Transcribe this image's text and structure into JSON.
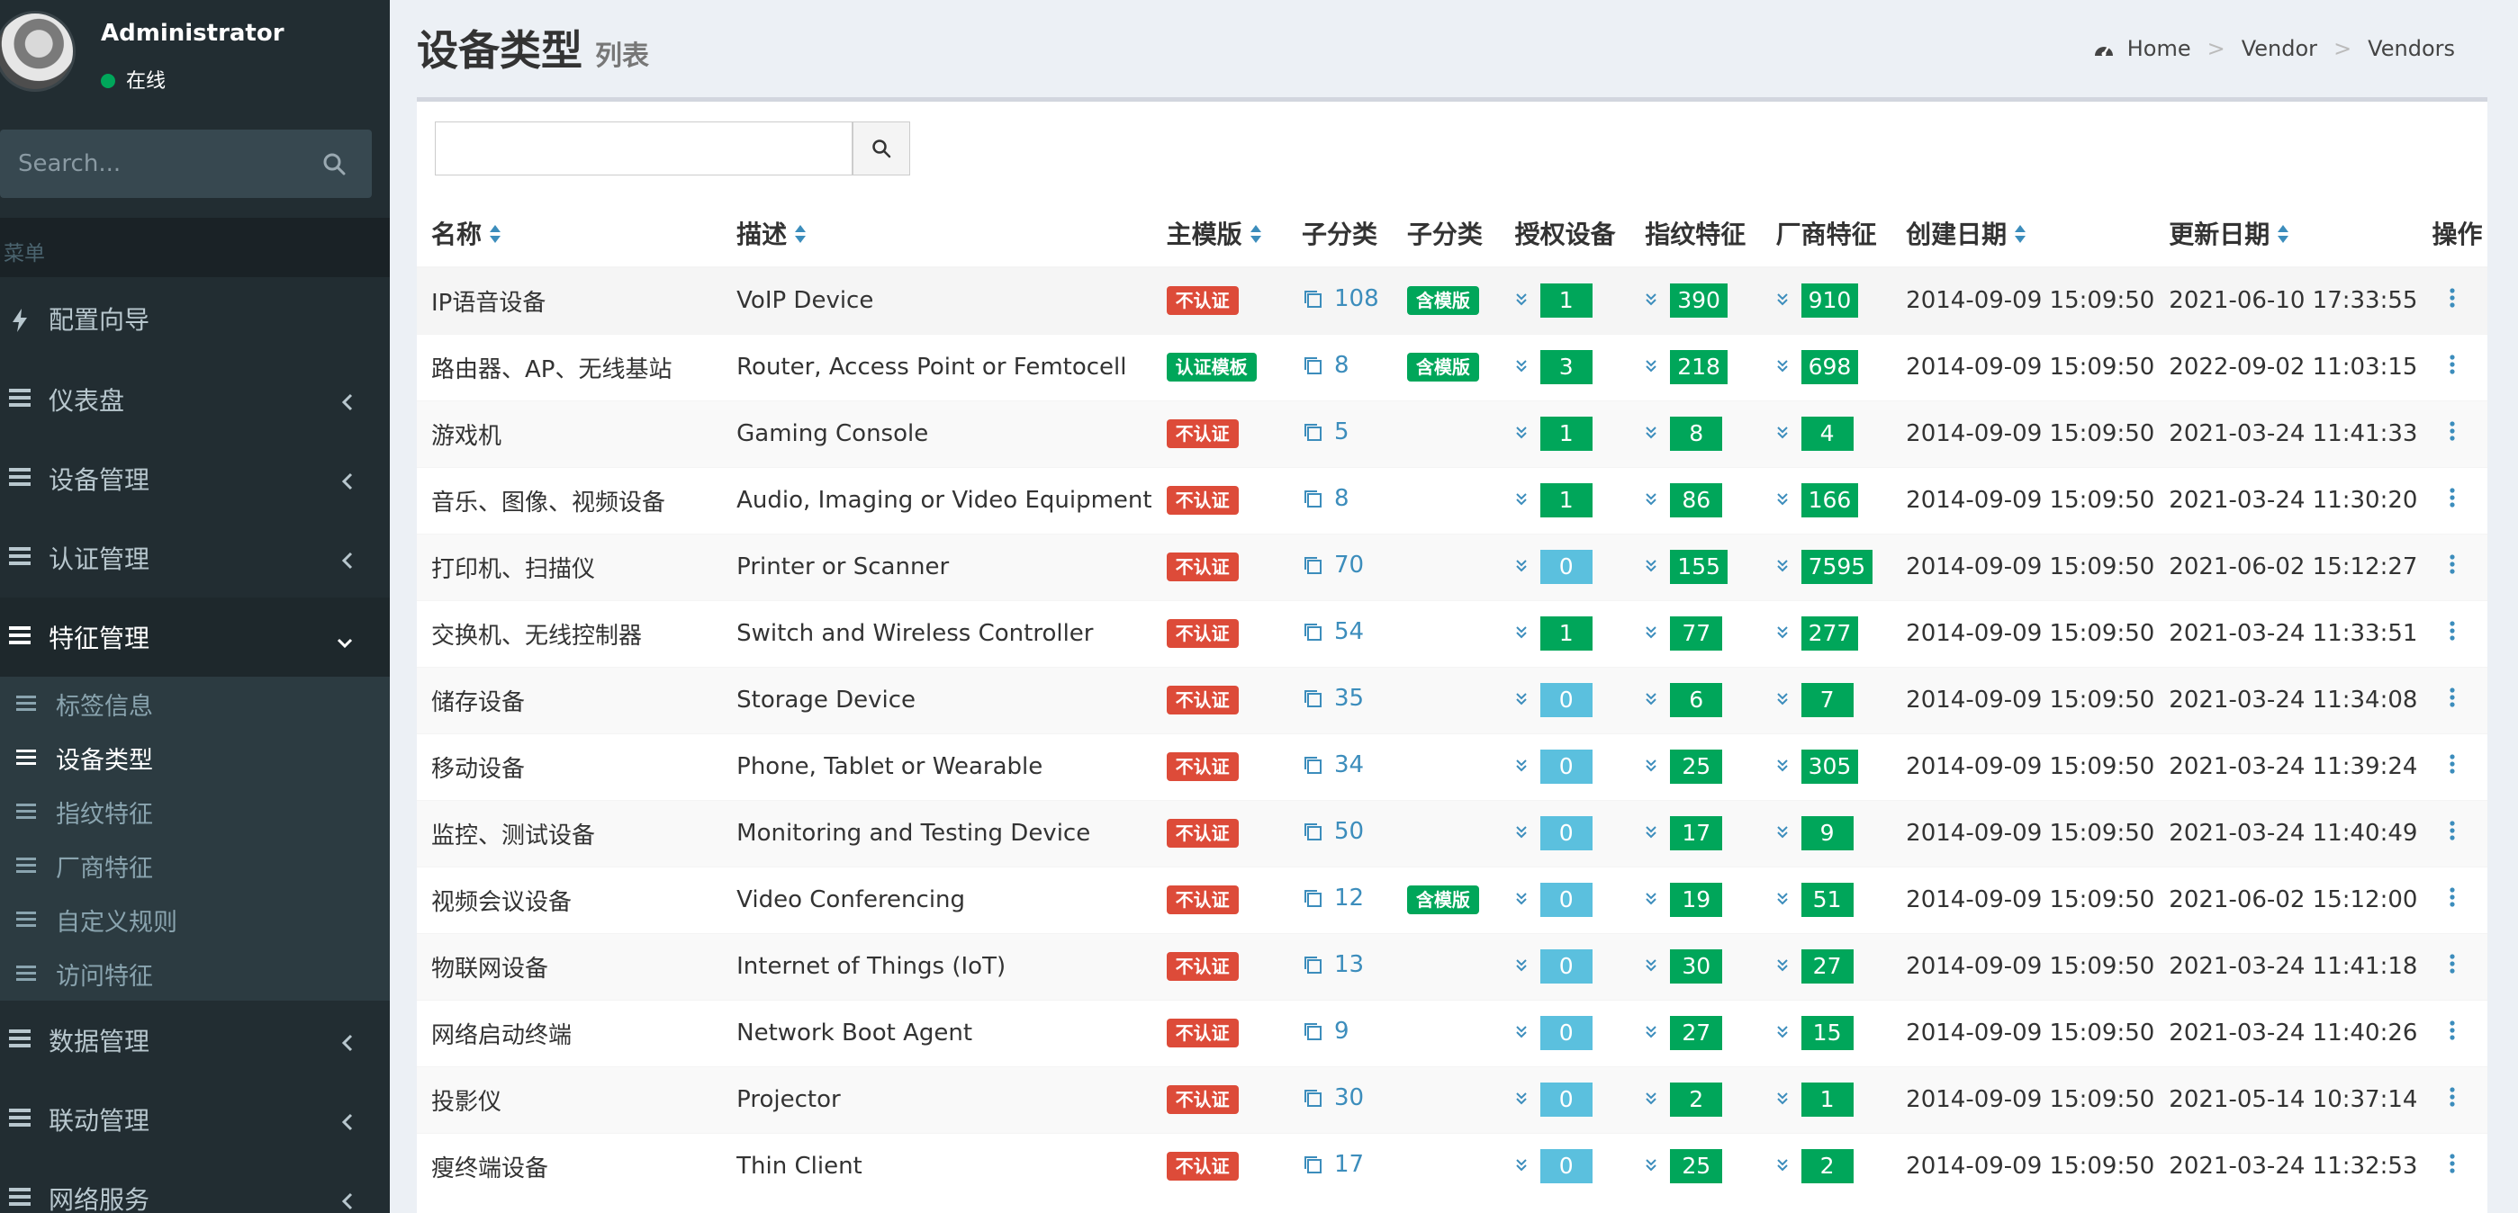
{
  "user": {
    "name": "Administrator",
    "status": "在线"
  },
  "sidebar": {
    "search_placeholder": "Search...",
    "menu_header": "菜单",
    "wizard": "配置向导",
    "items": [
      {
        "label": "仪表盘"
      },
      {
        "label": "设备管理"
      },
      {
        "label": "认证管理"
      },
      {
        "label": "特征管理"
      },
      {
        "label": "数据管理"
      },
      {
        "label": "联动管理"
      },
      {
        "label": "网络服务"
      }
    ],
    "sub_items": [
      {
        "label": "标签信息"
      },
      {
        "label": "设备类型"
      },
      {
        "label": "指纹特征"
      },
      {
        "label": "厂商特征"
      },
      {
        "label": "自定义规则"
      },
      {
        "label": "访问特征"
      }
    ]
  },
  "page": {
    "title": "设备类型",
    "subtitle": "列表"
  },
  "breadcrumb": [
    "Home",
    "Vendor",
    "Vendors"
  ],
  "table": {
    "headers": [
      "名称",
      "描述",
      "主模版",
      "子分类",
      "子分类",
      "授权设备",
      "指纹特征",
      "厂商特征",
      "创建日期",
      "更新日期",
      "操作"
    ],
    "rows": [
      {
        "name": "IP语音设备",
        "desc": "VoIP Device",
        "tpl": "不认证",
        "sub": "108",
        "subtpl": "含模版",
        "auth": "1",
        "fp": "390",
        "vendor": "910",
        "created": "2014-09-09 15:09:50",
        "updated": "2021-06-10 17:33:55"
      },
      {
        "name": "路由器、AP、无线基站",
        "desc": "Router, Access Point or Femtocell",
        "tpl": "认证模板",
        "sub": "8",
        "subtpl": "含模版",
        "auth": "3",
        "fp": "218",
        "vendor": "698",
        "created": "2014-09-09 15:09:50",
        "updated": "2022-09-02 11:03:15"
      },
      {
        "name": "游戏机",
        "desc": "Gaming Console",
        "tpl": "不认证",
        "sub": "5",
        "subtpl": "",
        "auth": "1",
        "fp": "8",
        "vendor": "4",
        "created": "2014-09-09 15:09:50",
        "updated": "2021-03-24 11:41:33"
      },
      {
        "name": "音乐、图像、视频设备",
        "desc": "Audio, Imaging or Video Equipment",
        "tpl": "不认证",
        "sub": "8",
        "subtpl": "",
        "auth": "1",
        "fp": "86",
        "vendor": "166",
        "created": "2014-09-09 15:09:50",
        "updated": "2021-03-24 11:30:20"
      },
      {
        "name": "打印机、扫描仪",
        "desc": "Printer or Scanner",
        "tpl": "不认证",
        "sub": "70",
        "subtpl": "",
        "auth": "0",
        "fp": "155",
        "vendor": "7595",
        "created": "2014-09-09 15:09:50",
        "updated": "2021-06-02 15:12:27"
      },
      {
        "name": "交换机、无线控制器",
        "desc": "Switch and Wireless Controller",
        "tpl": "不认证",
        "sub": "54",
        "subtpl": "",
        "auth": "1",
        "fp": "77",
        "vendor": "277",
        "created": "2014-09-09 15:09:50",
        "updated": "2021-03-24 11:33:51"
      },
      {
        "name": "储存设备",
        "desc": "Storage Device",
        "tpl": "不认证",
        "sub": "35",
        "subtpl": "",
        "auth": "0",
        "fp": "6",
        "vendor": "7",
        "created": "2014-09-09 15:09:50",
        "updated": "2021-03-24 11:34:08"
      },
      {
        "name": "移动设备",
        "desc": "Phone, Tablet or Wearable",
        "tpl": "不认证",
        "sub": "34",
        "subtpl": "",
        "auth": "0",
        "fp": "25",
        "vendor": "305",
        "created": "2014-09-09 15:09:50",
        "updated": "2021-03-24 11:39:24"
      },
      {
        "name": "监控、测试设备",
        "desc": "Monitoring and Testing Device",
        "tpl": "不认证",
        "sub": "50",
        "subtpl": "",
        "auth": "0",
        "fp": "17",
        "vendor": "9",
        "created": "2014-09-09 15:09:50",
        "updated": "2021-03-24 11:40:49"
      },
      {
        "name": "视频会议设备",
        "desc": "Video Conferencing",
        "tpl": "不认证",
        "sub": "12",
        "subtpl": "含模版",
        "auth": "0",
        "fp": "19",
        "vendor": "51",
        "created": "2014-09-09 15:09:50",
        "updated": "2021-06-02 15:12:00"
      },
      {
        "name": "物联网设备",
        "desc": "Internet of Things (IoT)",
        "tpl": "不认证",
        "sub": "13",
        "subtpl": "",
        "auth": "0",
        "fp": "30",
        "vendor": "27",
        "created": "2014-09-09 15:09:50",
        "updated": "2021-03-24 11:41:18"
      },
      {
        "name": "网络启动终端",
        "desc": "Network Boot Agent",
        "tpl": "不认证",
        "sub": "9",
        "subtpl": "",
        "auth": "0",
        "fp": "27",
        "vendor": "15",
        "created": "2014-09-09 15:09:50",
        "updated": "2021-03-24 11:40:26"
      },
      {
        "name": "投影仪",
        "desc": "Projector",
        "tpl": "不认证",
        "sub": "30",
        "subtpl": "",
        "auth": "0",
        "fp": "2",
        "vendor": "1",
        "created": "2014-09-09 15:09:50",
        "updated": "2021-05-14 10:37:14"
      },
      {
        "name": "瘦终端设备",
        "desc": "Thin Client",
        "tpl": "不认证",
        "sub": "17",
        "subtpl": "",
        "auth": "0",
        "fp": "25",
        "vendor": "2",
        "created": "2014-09-09 15:09:50",
        "updated": "2021-03-24 11:32:53"
      }
    ]
  },
  "colors": {
    "sidebar_bg": "#222d32",
    "red_label": "#dd4b39",
    "green": "#00a65a",
    "blue_badge": "#5bc0de",
    "link": "#3c8dbc"
  }
}
